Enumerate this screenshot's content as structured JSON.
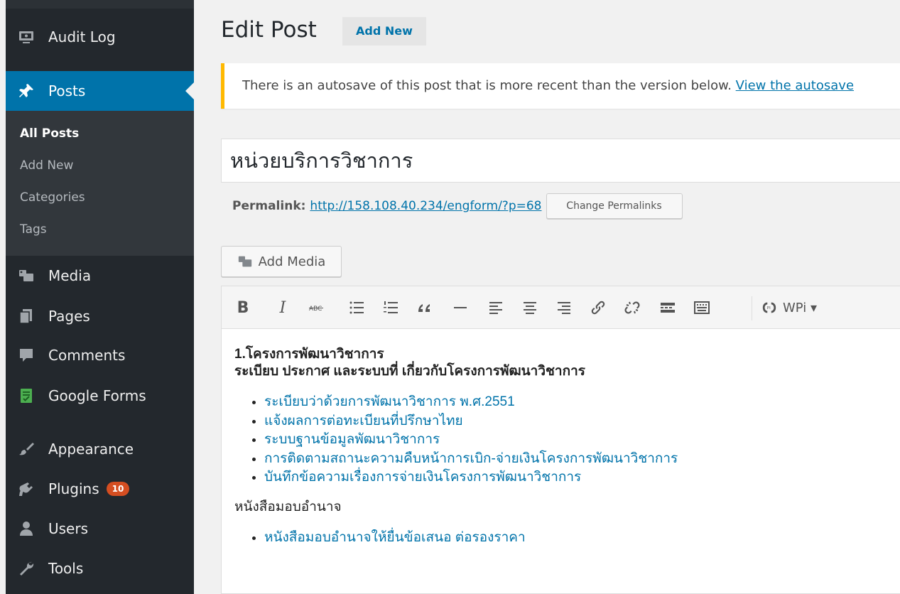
{
  "sidebar": {
    "items": [
      {
        "id": "audit-log",
        "label": "Audit Log",
        "icon": "monitor-icon"
      },
      {
        "id": "posts",
        "label": "Posts",
        "icon": "pushpin-icon",
        "active": true
      },
      {
        "id": "media",
        "label": "Media",
        "icon": "media-icon"
      },
      {
        "id": "pages",
        "label": "Pages",
        "icon": "pages-icon"
      },
      {
        "id": "comments",
        "label": "Comments",
        "icon": "comment-icon"
      },
      {
        "id": "google-forms",
        "label": "Google Forms",
        "icon": "google-forms-icon"
      },
      {
        "id": "appearance",
        "label": "Appearance",
        "icon": "paintbrush-icon"
      },
      {
        "id": "plugins",
        "label": "Plugins",
        "icon": "plug-icon",
        "badge": "10"
      },
      {
        "id": "users",
        "label": "Users",
        "icon": "user-icon"
      },
      {
        "id": "tools",
        "label": "Tools",
        "icon": "wrench-icon"
      }
    ],
    "submenu": [
      "All Posts",
      "Add New",
      "Categories",
      "Tags"
    ],
    "accent_color": "#0073aa",
    "background": "#23282d"
  },
  "header": {
    "title": "Edit Post",
    "add_new": "Add New"
  },
  "notice": {
    "text": "There is an autosave of this post that is more recent than the version below. ",
    "link": "View the autosave"
  },
  "post": {
    "title": "หน่วยบริการวิชาการ",
    "permalink_label": "Permalink:",
    "permalink_url": "http://158.108.40.234/engform/?p=68",
    "change_permalinks": "Change Permalinks",
    "add_media": "Add Media"
  },
  "toolbar": {
    "buttons": [
      "bold",
      "italic",
      "strikethrough",
      "bullet-list",
      "numbered-list",
      "blockquote",
      "horizontal-rule",
      "align-left",
      "align-center",
      "align-right",
      "insert-link",
      "remove-link",
      "read-more",
      "toolbar-toggle"
    ],
    "bold_label": "B",
    "italic_label": "I",
    "wpi_label": "WPi ▾"
  },
  "content": {
    "heading1": "1.โครงการพัฒนาวิชาการ",
    "heading2": "ระเบียบ ประกาศ และระบบที่ เกี่ยวกับโครงการพัฒนาวิชาการ",
    "list1": [
      "ระเบียบว่าด้วยการพัฒนาวิชาการ พ.ศ.2551",
      "แจ้งผลการต่อทะเบียนที่ปรึกษาไทย",
      "ระบบฐานข้อมูลพัฒนาวิชาการ",
      "การติดตามสถานะความคืบหน้าการเบิก-จ่ายเงินโครงการพัฒนาวิชาการ",
      "บันทึกข้อความเรื่องการจ่ายเงินโครงการพัฒนาวิชาการ"
    ],
    "para": "หนังสือมอบอำนาจ",
    "list2": [
      "หนังสือมอบอำนาจให้ยื่นข้อเสนอ ต่อรองราคา"
    ]
  }
}
